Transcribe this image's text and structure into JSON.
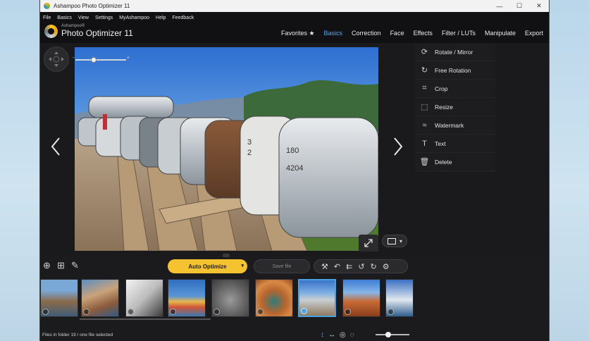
{
  "window": {
    "title": "Ashampoo Photo Optimizer 11",
    "controls": [
      "—",
      "☐",
      "✕"
    ]
  },
  "menu": [
    "File",
    "Basics",
    "View",
    "Settings",
    "MyAshampoo",
    "Help",
    "Feedback"
  ],
  "header": {
    "brand": "Ashampoo®",
    "product": "Photo Optimizer 11",
    "tabs": [
      "Favorites ★",
      "Basics",
      "Correction",
      "Face",
      "Effects",
      "Filter / LUTs",
      "Manipulate",
      "Export"
    ],
    "active_tab": "Basics"
  },
  "viewer": {
    "prev_glyph": "‹",
    "next_glyph": "›",
    "zoom_minus": "-",
    "zoom_plus": "+",
    "zoom_level": 0.35
  },
  "tools": [
    {
      "label": "Rotate / Mirror",
      "icon": "rotate-icon"
    },
    {
      "label": "Free Rotation",
      "icon": "free-rotation-icon"
    },
    {
      "label": "Crop",
      "icon": "crop-icon"
    },
    {
      "label": "Resize",
      "icon": "resize-icon"
    },
    {
      "label": "Watermark",
      "icon": "watermark-icon"
    },
    {
      "label": "Text",
      "icon": "text-icon"
    },
    {
      "label": "Delete",
      "icon": "delete-icon"
    }
  ],
  "actions": {
    "auto_optimize": "Auto Optimize",
    "save_file": "Save file"
  },
  "filmstrip": {
    "thumbnails": [
      {
        "subject": "coastal cliffs",
        "selected": false
      },
      {
        "subject": "seaside village",
        "selected": false
      },
      {
        "subject": "pier black and white",
        "selected": false
      },
      {
        "subject": "colorful beach huts",
        "selected": false
      },
      {
        "subject": "route 66 sign",
        "selected": false
      },
      {
        "subject": "horseshoe bend",
        "selected": false
      },
      {
        "subject": "mailboxes",
        "selected": true
      },
      {
        "subject": "desert mesas",
        "selected": false
      },
      {
        "subject": "harbor town",
        "selected": false
      }
    ]
  },
  "status": {
    "text": "Files in folder 19 / one file selected"
  },
  "colors": {
    "accent": "#5aa9e8",
    "button_primary": "#f5c230",
    "background": "#1b1b1d"
  }
}
